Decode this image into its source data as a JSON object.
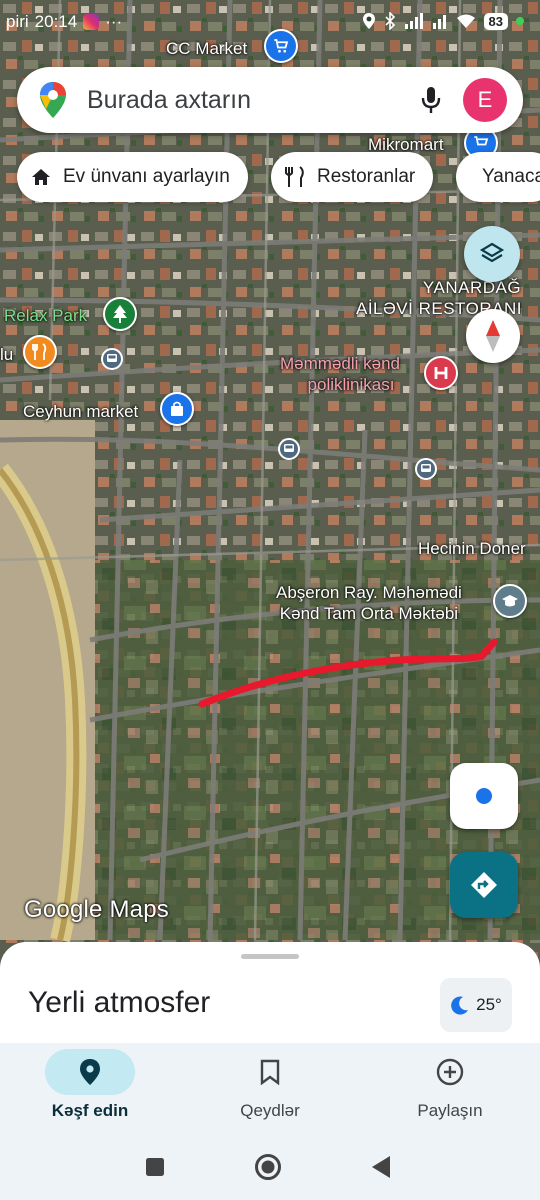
{
  "status_bar": {
    "carrier": "piri",
    "time": "20:14",
    "extra": "···",
    "battery": "83"
  },
  "search": {
    "placeholder": "Burada axtarın",
    "avatar_letter": "E"
  },
  "chips": [
    {
      "label": "Ev ünvanı ayarlayın",
      "icon": "home-icon"
    },
    {
      "label": "Restoranlar",
      "icon": "restaurant-icon"
    },
    {
      "label": "Yanacaq",
      "icon": "fuel-icon"
    }
  ],
  "map_labels": {
    "cc_market": "CC Market",
    "mikromart": "Mikromart",
    "yanardag_line1": "YANARDAĞ",
    "yanardag_line2": "AİLƏVİ RESTORANI",
    "relax_park": "Relax Park",
    "lu": "lu",
    "poliklinika_line1": "Məmmədli kənd",
    "poliklinika_line2": "poliklinikası",
    "ceyhun_market": "Ceyhun market",
    "hecinin_doner": "Hecinin Doner",
    "school_line1": "Abşeron Ray. Məhəmədi",
    "school_line2": "Kənd Tam Orta Məktəbi",
    "google_maps_logo": "Google Maps"
  },
  "bottom_sheet": {
    "title": "Yerli atmosfer",
    "temperature": "25°"
  },
  "bottom_nav": [
    {
      "label": "Kəşf edin",
      "icon": "explore-pin-icon",
      "active": true
    },
    {
      "label": "Qeydlər",
      "icon": "bookmark-icon",
      "active": false
    },
    {
      "label": "Paylaşın",
      "icon": "add-circle-icon",
      "active": false
    }
  ],
  "colors": {
    "route": "#e8192c",
    "accent": "#1a73e8",
    "directions_button": "#0b7285",
    "nav_active": "#c3e9f2",
    "avatar": "#e8336f"
  }
}
